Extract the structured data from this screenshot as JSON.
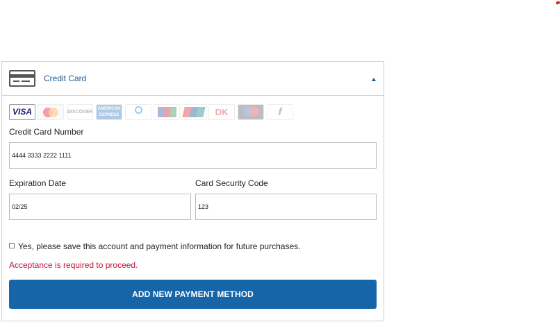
{
  "payment_panel": {
    "header": {
      "title": "Credit Card",
      "card_icon": "credit-card-icon",
      "toggle_icon": "caret-up-icon"
    },
    "card_logos": [
      {
        "name": "visa",
        "text": "VISA"
      },
      {
        "name": "mastercard",
        "text": ""
      },
      {
        "name": "discover",
        "text": "DISCOVER"
      },
      {
        "name": "american-express",
        "text": "AMERICAN EXPRESS"
      },
      {
        "name": "diners-club",
        "text": "Diners Club"
      },
      {
        "name": "jcb",
        "text": "JCB"
      },
      {
        "name": "unionpay",
        "text": "UnionPay"
      },
      {
        "name": "dankort",
        "text": "DK"
      },
      {
        "name": "maestro",
        "text": ""
      },
      {
        "name": "forbrugsforeningen",
        "text": "f"
      }
    ],
    "card_number": {
      "label": "Credit Card Number",
      "value": "4444 3333 2222 1111"
    },
    "expiration": {
      "label": "Expiration Date",
      "value": "02/25"
    },
    "security_code": {
      "label": "Card Security Code",
      "value": "123"
    },
    "save_checkbox": {
      "label": "Yes, please save this account and payment information for future purchases.",
      "checked": false
    },
    "error_message": "Acceptance is required to proceed.",
    "submit_button": "ADD NEW PAYMENT METHOD"
  },
  "colors": {
    "accent": "#1565a8",
    "header_text": "#1e5a96",
    "error": "#c0143c",
    "border": "#cfcfcf"
  }
}
